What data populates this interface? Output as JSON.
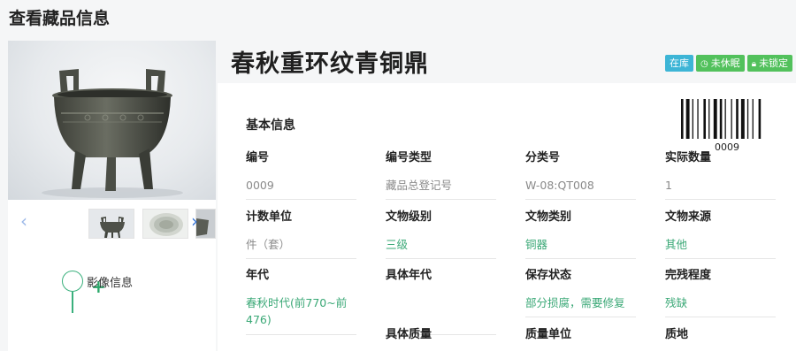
{
  "header": {
    "page_title": "查看藏品信息"
  },
  "object": {
    "title": "春秋重环纹青铜鼎",
    "badges": {
      "in_stock": "在库",
      "not_dormant": "未休眠",
      "not_locked": "未锁定"
    },
    "barcode_number": "0009"
  },
  "gallery": {
    "thumbnail_count": 3
  },
  "sidebar": {
    "image_info_label": "影像信息"
  },
  "basic_info": {
    "heading": "基本信息",
    "fields": [
      {
        "label": "编号",
        "value": "0009"
      },
      {
        "label": "编号类型",
        "value": "藏品总登记号"
      },
      {
        "label": "分类号",
        "value": "W-08:QT008"
      },
      {
        "label": "实际数量",
        "value": "1"
      },
      {
        "label": "计数单位",
        "value": "件（套）"
      },
      {
        "label": "文物级别",
        "value": "三级"
      },
      {
        "label": "文物类别",
        "value": "铜器"
      },
      {
        "label": "文物来源",
        "value": "其他"
      },
      {
        "label": "年代",
        "value": "春秋时代(前770~前476)"
      },
      {
        "label": "具体年代",
        "value": ""
      },
      {
        "label": "保存状态",
        "value": "部分损腐，需要修复"
      },
      {
        "label": "完残程度",
        "value": "残缺"
      },
      {
        "label": "具体质量",
        "value": ""
      },
      {
        "label": "质量单位",
        "value": ""
      },
      {
        "label": "质地",
        "value": ""
      }
    ]
  },
  "colors": {
    "accent_green": "#3aa876",
    "badge_blue": "#3db5d6",
    "badge_green": "#52c15c",
    "arrow_blue": "#3a78d8"
  }
}
